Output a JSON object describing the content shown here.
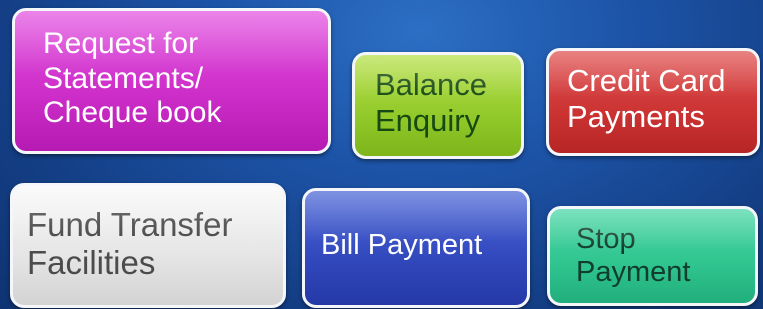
{
  "buttons": {
    "statements": {
      "label": "Request for\nStatements/\nCheque book"
    },
    "balance": {
      "label": "Balance\nEnquiry"
    },
    "credit_card": {
      "label": "Credit Card\nPayments"
    },
    "fund_transfer": {
      "label": "Fund Transfer\nFacilities"
    },
    "bill_payment": {
      "label": "Bill Payment"
    },
    "stop_payment": {
      "label": "Stop\nPayment"
    }
  },
  "colors": {
    "background": "#1d54a8",
    "statements": "#cd2dc8",
    "balance": "#92c92a",
    "credit_card": "#cc3333",
    "fund_transfer": "#e5e5e5",
    "bill_payment": "#3148bd",
    "stop_payment": "#2fc48f"
  }
}
